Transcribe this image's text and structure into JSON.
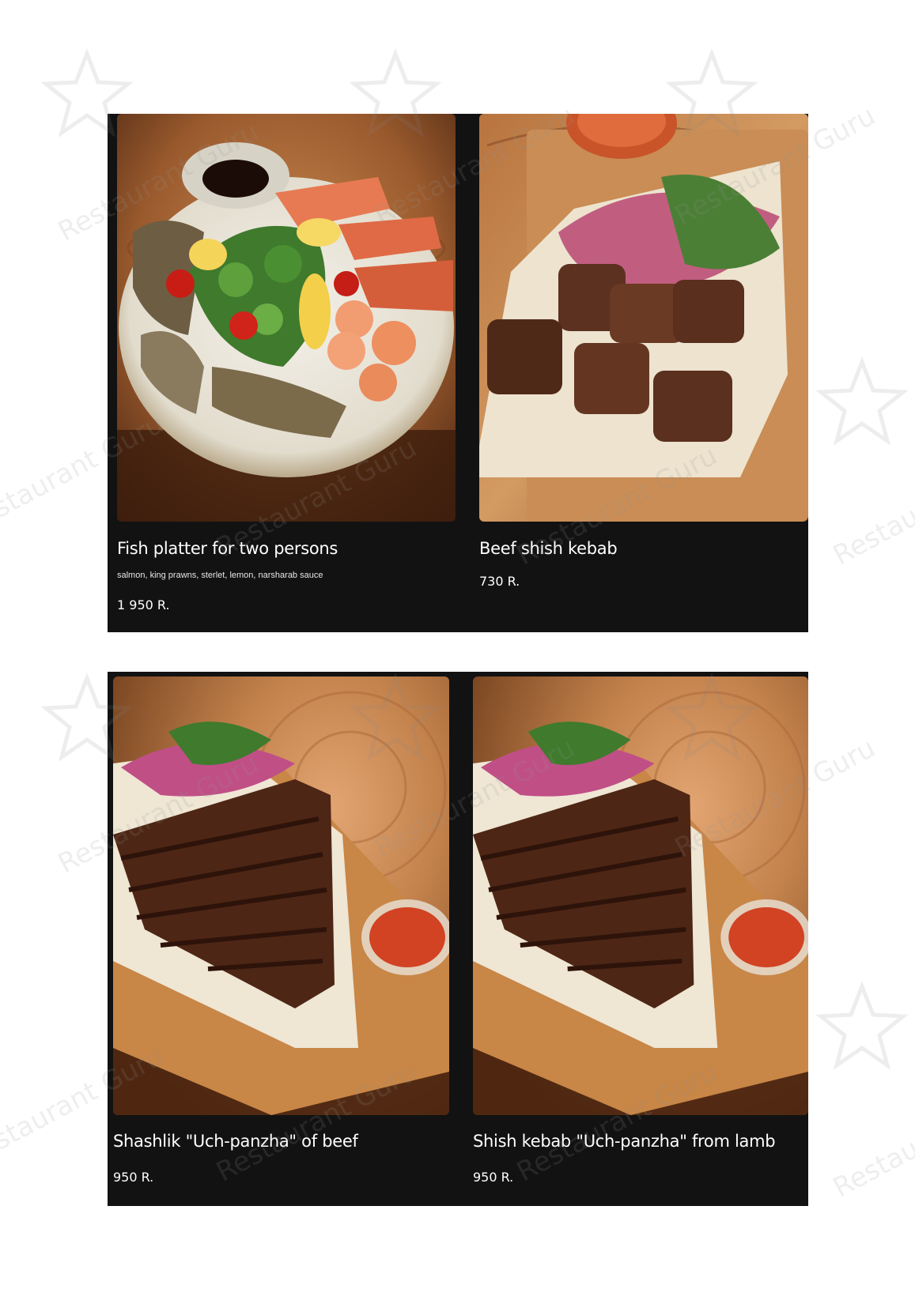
{
  "watermark": {
    "text": "Restaurant Guru"
  },
  "menu": {
    "items": [
      {
        "name": "Fish platter for two persons",
        "description": "salmon, king prawns, sterlet, lemon, narsharab sauce",
        "price": "1 950 R.",
        "image": "fish-platter-photo"
      },
      {
        "name": "Beef shish kebab",
        "price": "730 R.",
        "image": "beef-shish-kebab-photo"
      },
      {
        "name": "Shashlik \"Uch-panzha\" of beef",
        "price": "950 R.",
        "image": "uch-panzha-beef-photo"
      },
      {
        "name": "Shish kebab \"Uch-panzha\" from lamb",
        "price": "950 R.",
        "image": "uch-panzha-lamb-photo"
      }
    ]
  },
  "colors": {
    "panel_background": "#121212",
    "page_background": "#ffffff",
    "text": "#ffffff",
    "wood": "#b8743f"
  }
}
